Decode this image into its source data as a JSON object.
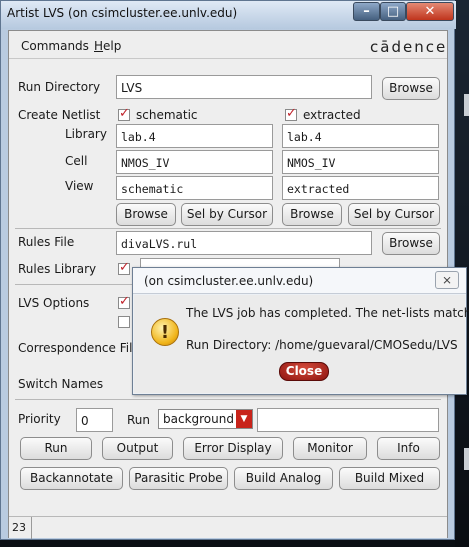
{
  "window": {
    "title": "Artist LVS (on csimcluster.ee.unlv.edu)",
    "min_glyph": "–",
    "max_glyph": "□",
    "close_glyph": "✕"
  },
  "menubar": {
    "commands": "Commands",
    "help_underlined": "H",
    "help_rest": "elp",
    "brand": "cādence"
  },
  "form": {
    "run_directory": {
      "label": "Run Directory",
      "value": "LVS",
      "browse": "Browse"
    },
    "create_netlist": {
      "label": "Create Netlist",
      "schematic": "schematic",
      "extracted": "extracted"
    },
    "library": {
      "label": "Library",
      "schematic": "lab.4",
      "extracted": "lab.4"
    },
    "cell": {
      "label": "Cell",
      "schematic": "NMOS_IV",
      "extracted": "NMOS_IV"
    },
    "view": {
      "label": "View",
      "schematic": "schematic",
      "extracted": "extracted"
    },
    "row_buttons": {
      "browse": "Browse",
      "sel_by_cursor": "Sel by Cursor"
    },
    "rules_file": {
      "label": "Rules File",
      "value": "divaLVS.rul",
      "browse": "Browse"
    },
    "rules_library": {
      "label": "Rules Library"
    },
    "lvs_options": {
      "label": "LVS Options"
    },
    "correspondence_file": {
      "label": "Correspondence Fil"
    },
    "switch_names": {
      "label": "Switch Names"
    },
    "priority": {
      "label": "Priority",
      "value": "0"
    },
    "run": {
      "label": "Run",
      "mode": "background"
    }
  },
  "actions": {
    "row1": [
      "Run",
      "Output",
      "Error Display",
      "Monitor",
      "Info"
    ],
    "row2": [
      "Backannotate",
      "Parasitic Probe",
      "Build Analog",
      "Build Mixed"
    ]
  },
  "status": {
    "line": "23"
  },
  "dialog": {
    "title": "(on csimcluster.ee.unlv.edu)",
    "close_glyph": "⨯",
    "message": "The LVS job has completed. The net-lists match.",
    "run_directory": "Run Directory: /home/guevaral/CMOSedu/LVS",
    "button": "Close"
  },
  "colors": {
    "accent": "#c8231a",
    "window_frame": "#b9cbe0"
  }
}
